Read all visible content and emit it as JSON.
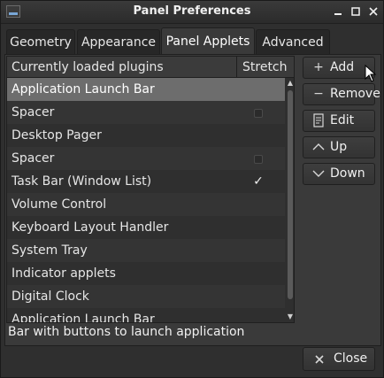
{
  "window": {
    "title": "Panel Preferences",
    "min_icon": "minimize-icon",
    "max_icon": "maximize-icon",
    "close_icon": "close-icon"
  },
  "tabs": [
    {
      "label": "Geometry"
    },
    {
      "label": "Appearance"
    },
    {
      "label": "Panel Applets"
    },
    {
      "label": "Advanced"
    }
  ],
  "list": {
    "col_plugins": "Currently loaded plugins",
    "col_stretch": "Stretch",
    "rows": [
      {
        "name": "Application Launch Bar",
        "stretch": ""
      },
      {
        "name": "Spacer",
        "stretch": "unchecked"
      },
      {
        "name": "Desktop Pager",
        "stretch": ""
      },
      {
        "name": "Spacer",
        "stretch": "unchecked"
      },
      {
        "name": "Task Bar (Window List)",
        "stretch": "checked"
      },
      {
        "name": "Volume Control",
        "stretch": ""
      },
      {
        "name": "Keyboard Layout Handler",
        "stretch": ""
      },
      {
        "name": "System Tray",
        "stretch": ""
      },
      {
        "name": "Indicator applets",
        "stretch": ""
      },
      {
        "name": "Digital Clock",
        "stretch": ""
      },
      {
        "name": "Application Launch Bar",
        "stretch": ""
      }
    ]
  },
  "description": "Bar with buttons to launch application",
  "buttons": {
    "add": "Add",
    "remove": "Remove",
    "edit": "Edit",
    "up": "Up",
    "down": "Down",
    "close": "Close"
  }
}
